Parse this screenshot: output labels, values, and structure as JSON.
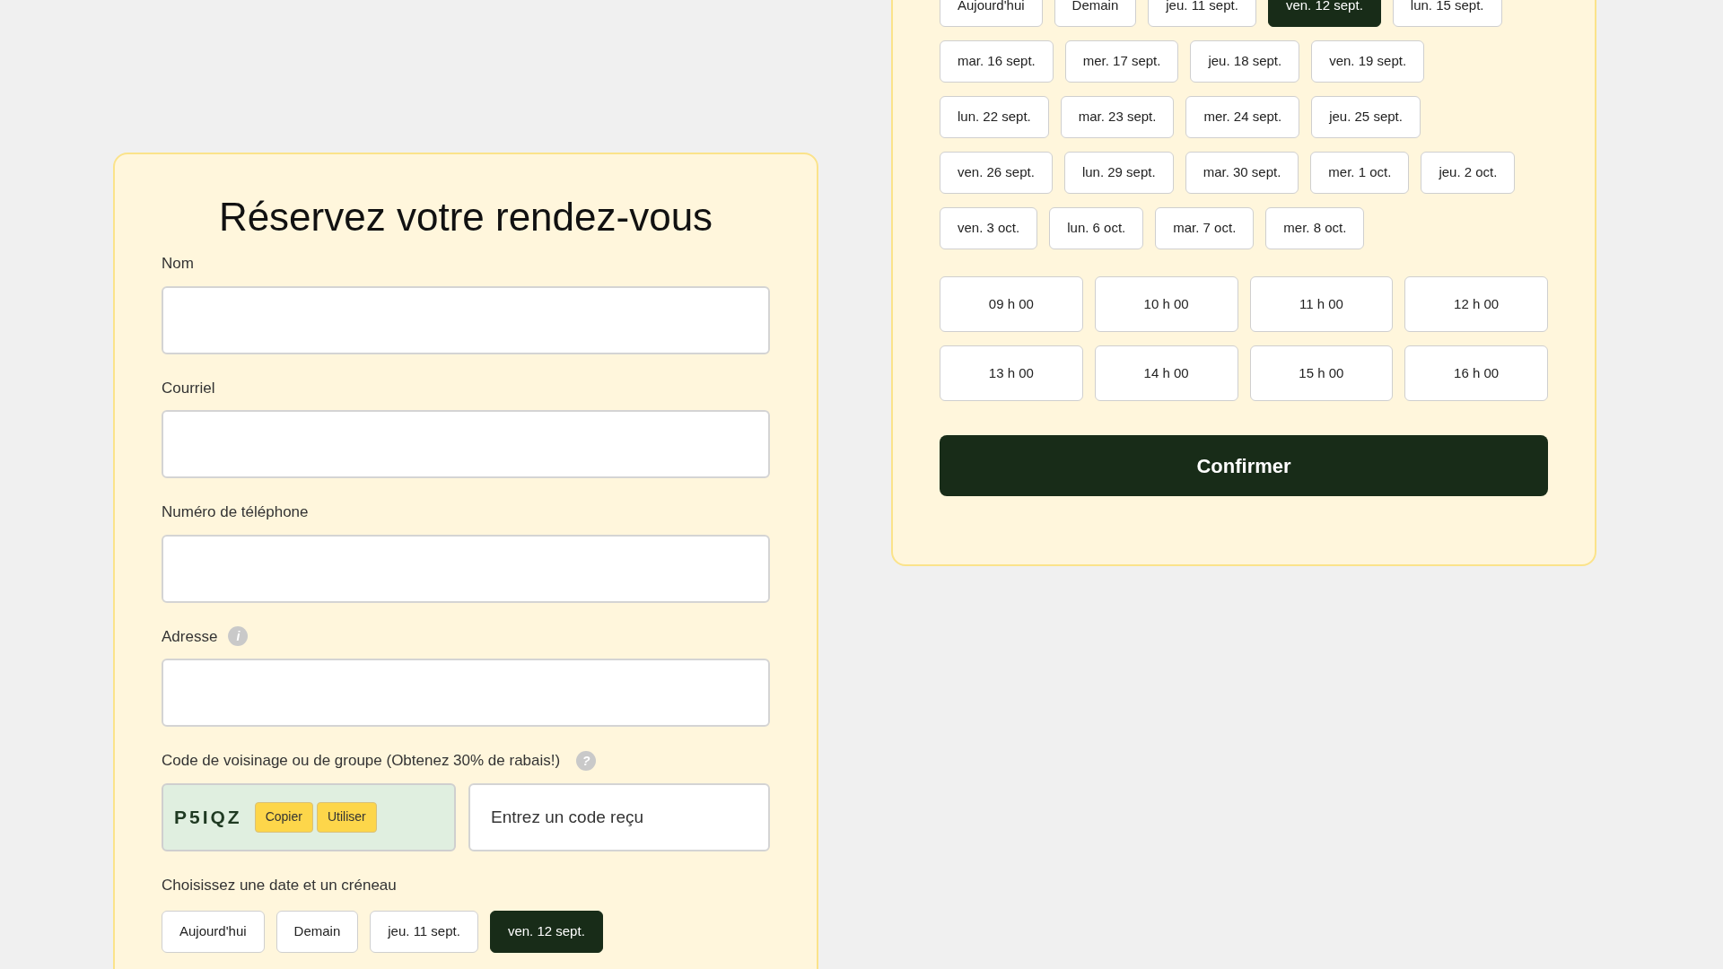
{
  "booking_form": {
    "title": "Réservez votre rendez-vous",
    "fields": [
      {
        "label": "Nom"
      },
      {
        "label": "Courriel"
      },
      {
        "label": "Numéro de téléphone"
      },
      {
        "label": "Adresse",
        "hint_icon": "i"
      }
    ],
    "code_section": {
      "label": "Code de voisinage ou de groupe (Obtenez 30% de rabais!)",
      "hint_icon": "?",
      "code": "P5IQZ",
      "buttons": [
        "Copier",
        "Utiliser"
      ],
      "input_placeholder": "Entrez un code reçu"
    },
    "date_section": {
      "label": "Choisissez une date et un créneau",
      "dates": [
        {
          "label": "Aujourd'hui",
          "selected": false
        },
        {
          "label": "Demain",
          "selected": false
        },
        {
          "label": "jeu. 11 sept.",
          "selected": false
        },
        {
          "label": "ven. 12 sept.",
          "selected": true
        }
      ]
    }
  },
  "schedule_panel": {
    "dates": [
      {
        "label": "Aujourd'hui",
        "selected": false
      },
      {
        "label": "Demain",
        "selected": false
      },
      {
        "label": "jeu. 11 sept.",
        "selected": false
      },
      {
        "label": "ven. 12 sept.",
        "selected": true
      },
      {
        "label": "lun. 15 sept.",
        "selected": false
      },
      {
        "label": "mar. 16 sept.",
        "selected": false
      },
      {
        "label": "mer. 17 sept.",
        "selected": false
      },
      {
        "label": "jeu. 18 sept.",
        "selected": false
      },
      {
        "label": "ven. 19 sept.",
        "selected": false
      },
      {
        "label": "lun. 22 sept.",
        "selected": false
      },
      {
        "label": "mar. 23 sept.",
        "selected": false
      },
      {
        "label": "mer. 24 sept.",
        "selected": false
      },
      {
        "label": "jeu. 25 sept.",
        "selected": false
      },
      {
        "label": "ven. 26 sept.",
        "selected": false
      },
      {
        "label": "lun. 29 sept.",
        "selected": false
      },
      {
        "label": "mar. 30 sept.",
        "selected": false
      },
      {
        "label": "mer. 1 oct.",
        "selected": false
      },
      {
        "label": "jeu. 2 oct.",
        "selected": false
      },
      {
        "label": "ven. 3 oct.",
        "selected": false
      },
      {
        "label": "lun. 6 oct.",
        "selected": false
      },
      {
        "label": "mar. 7 oct.",
        "selected": false
      },
      {
        "label": "mer. 8 oct.",
        "selected": false
      }
    ],
    "times": [
      {
        "label": "09 h 00",
        "selected": false
      },
      {
        "label": "10 h 00",
        "selected": false
      },
      {
        "label": "11 h 00",
        "selected": false
      },
      {
        "label": "12 h 00",
        "selected": false
      },
      {
        "label": "13 h 00",
        "selected": false
      },
      {
        "label": "14 h 00",
        "selected": false
      },
      {
        "label": "15 h 00",
        "selected": false
      },
      {
        "label": "16 h 00",
        "selected": false
      }
    ],
    "confirm_button": "Confirmer"
  }
}
